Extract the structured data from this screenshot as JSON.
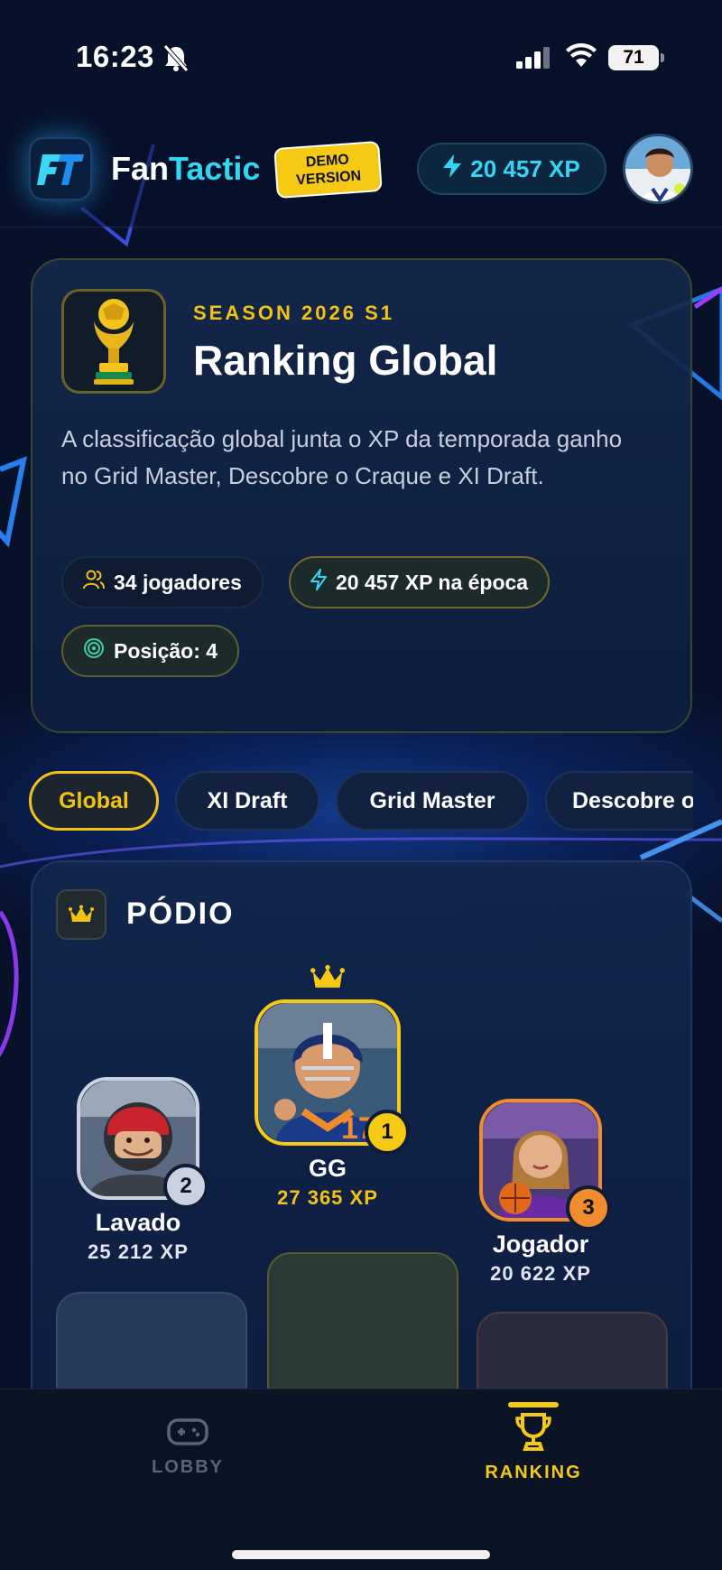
{
  "status_bar": {
    "time": "16:23",
    "battery": "71",
    "bell_icon": "bell-slash-icon",
    "signal_icon": "cellular-signal-icon",
    "wifi_icon": "wifi-icon"
  },
  "header": {
    "app_name_part1": "Fan",
    "app_name_part2": "Tactic",
    "logo_icon": "ft-logo-icon",
    "demo_badge": "DEMO\nVERSION",
    "xp": "20 457 XP",
    "xp_icon": "lightning-icon",
    "avatar": "user-avatar"
  },
  "season": {
    "label": "SEASON 2026 S1",
    "title": "Ranking Global",
    "trophy_icon": "trophy-icon",
    "description": "A classificação global junta o XP da temporada ganho no Grid Master, Descobre o Craque e XI Draft.",
    "chips": {
      "players": "34 jogadores",
      "season_xp": "20 457 XP na época",
      "position": "Posição: 4"
    }
  },
  "tabs": [
    {
      "label": "Global",
      "active": true
    },
    {
      "label": "XI Draft",
      "active": false
    },
    {
      "label": "Grid Master",
      "active": false
    },
    {
      "label": "Descobre o Craque",
      "active": false
    }
  ],
  "podium": {
    "title": "PÓDIO",
    "crown_icon": "crown-icon",
    "players": [
      {
        "rank": "2",
        "name": "Lavado",
        "xp": "25 212 XP"
      },
      {
        "rank": "1",
        "name": "GG",
        "xp": "27 365 XP"
      },
      {
        "rank": "3",
        "name": "Jogador",
        "xp": "20 622 XP"
      }
    ]
  },
  "bottom_nav": {
    "lobby": "LOBBY",
    "ranking": "RANKING"
  },
  "colors": {
    "accent_gold": "#f2c316",
    "accent_cyan": "#2fd8f0",
    "background": "#07112a",
    "rank_1": "#f6c914",
    "rank_2": "#c9d2de",
    "rank_3": "#f08c2e"
  }
}
